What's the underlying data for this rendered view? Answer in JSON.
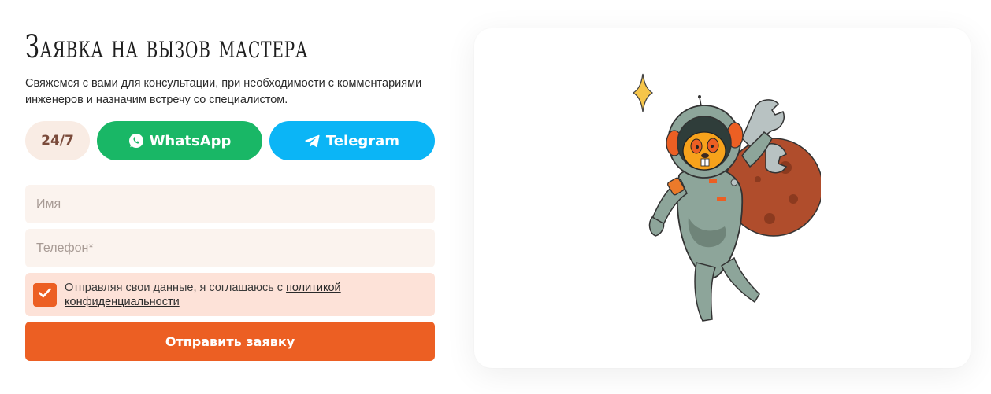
{
  "form": {
    "title": "Заявка на вызов мастера",
    "subtitle": "Свяжемся с вами для консультации, при необходимости с комментариями инженеров и назначим встречу со специалистом.",
    "availability": "24/7",
    "whatsapp_label": "WhatsApp",
    "telegram_label": "Telegram",
    "name_placeholder": "Имя",
    "phone_placeholder": "Телефон*",
    "consent_text": "Отправляя свои данные, я соглашаюсь с",
    "consent_link": "политикой конфиденциальности",
    "consent_checked": true,
    "submit_label": "Отправить заявку"
  },
  "colors": {
    "accent": "#ec5f23",
    "whatsapp": "#19b766",
    "telegram": "#0bb5f6",
    "field_bg": "#fbf3ee",
    "consent_bg": "#fde2d8"
  },
  "illustration": {
    "icon": "astronaut-beaver-illustration"
  }
}
